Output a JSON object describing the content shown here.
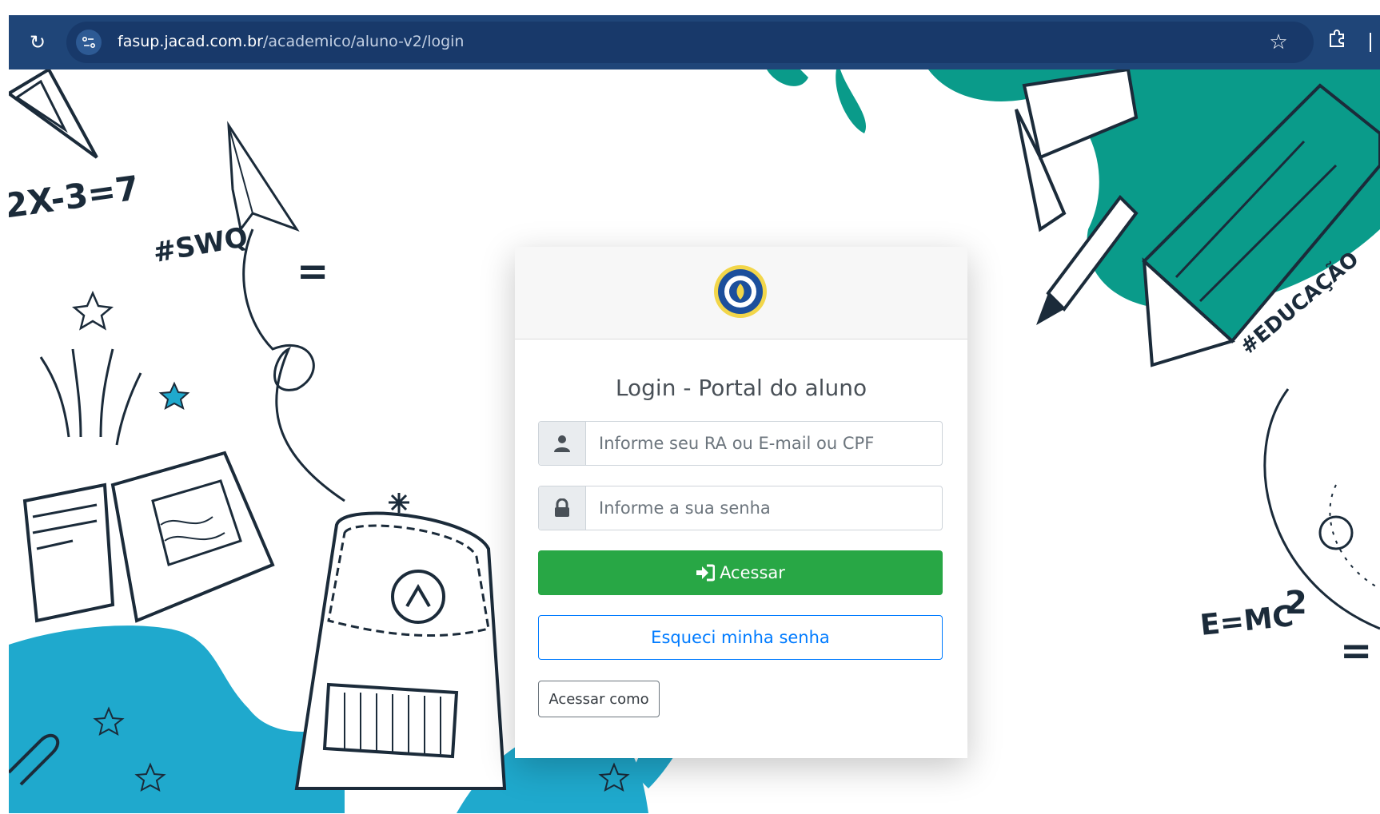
{
  "browser": {
    "url_host": "fasup.jacad.com.br",
    "url_path": "/academico/aluno-v2/login"
  },
  "background": {
    "doodles": [
      "2X-3=7",
      "#SWQ",
      "=",
      "#EDUCAÇÃO",
      "E=MC",
      "2",
      "="
    ]
  },
  "login": {
    "title": "Login - Portal do aluno",
    "user_placeholder": "Informe seu RA ou E-mail ou CPF",
    "password_placeholder": "Informe a sua senha",
    "submit_label": "Acessar",
    "forgot_label": "Esqueci minha senha",
    "login_as_label": "Acessar como"
  },
  "colors": {
    "browser_bar": "#1f4578",
    "teal": "#0a9b8a",
    "cyan": "#1fa9cd",
    "success": "#28a745",
    "primary": "#007bff"
  }
}
